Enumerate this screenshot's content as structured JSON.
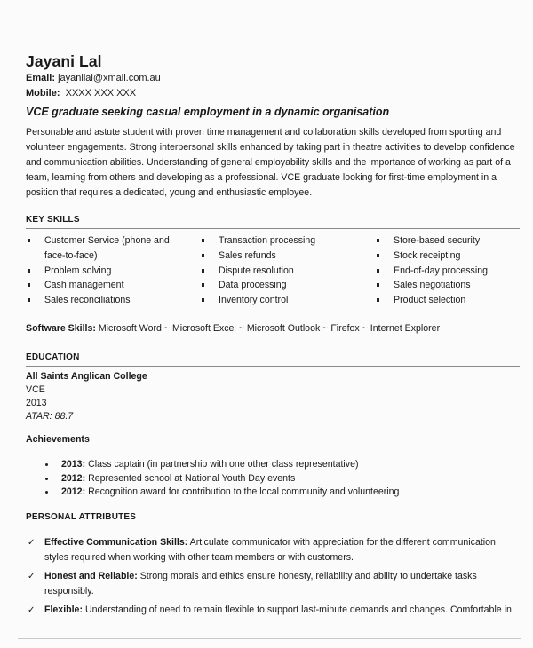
{
  "header": {
    "name": "Jayani Lal",
    "email_label": "Email:",
    "email_value": "jayanilal@xmail.com.au",
    "mobile_label": "Mobile:",
    "mobile_value": "XXXX XXX XXX",
    "tagline": "VCE graduate seeking casual employment in a dynamic organisation"
  },
  "summary": "Personable and astute student with proven time management and collaboration skills developed from sporting and volunteer engagements. Strong interpersonal skills enhanced by taking part in theatre activities to develop confidence and communication abilities. Understanding of general employability skills and the importance of working as part of a team, learning from others and developing as a professional. VCE graduate looking for first-time employment in a position that requires a dedicated, young and enthusiastic employee.",
  "key_skills": {
    "heading": "KEY SKILLS",
    "columns": [
      [
        "Customer Service (phone and face-to-face)",
        "Problem solving",
        "Cash management",
        "Sales reconciliations"
      ],
      [
        "Transaction processing",
        "Sales refunds",
        "Dispute resolution",
        "Data processing",
        "Inventory control"
      ],
      [
        "Store-based security",
        "Stock receipting",
        "End-of-day processing",
        "Sales negotiations",
        "Product selection"
      ]
    ]
  },
  "software": {
    "label": "Software Skills:",
    "value": "Microsoft Word ~ Microsoft Excel ~ Microsoft Outlook ~ Firefox ~ Internet Explorer"
  },
  "education": {
    "heading": "EDUCATION",
    "school": "All Saints Anglican College",
    "qualification": "VCE",
    "year": "2013",
    "atar": "ATAR: 88.7",
    "achievements_heading": "Achievements",
    "achievements": [
      {
        "year": "2013:",
        "text": "Class captain (in partnership with one other class representative)"
      },
      {
        "year": "2012:",
        "text": "Represented school at National Youth Day events"
      },
      {
        "year": "2012:",
        "text": "Recognition award for contribution to the local community and volunteering"
      }
    ]
  },
  "personal_attributes": {
    "heading": "PERSONAL ATTRIBUTES",
    "items": [
      {
        "title": "Effective Communication Skills:",
        "text": "Articulate communicator with appreciation for the different communication styles required when working with other team members or with customers."
      },
      {
        "title": "Honest and Reliable:",
        "text": "Strong morals and ethics ensure honesty, reliability and ability to undertake tasks responsibly."
      },
      {
        "title": "Flexible:",
        "text": "Understanding of need to remain flexible to support last-minute demands and changes. Comfortable in"
      }
    ]
  }
}
